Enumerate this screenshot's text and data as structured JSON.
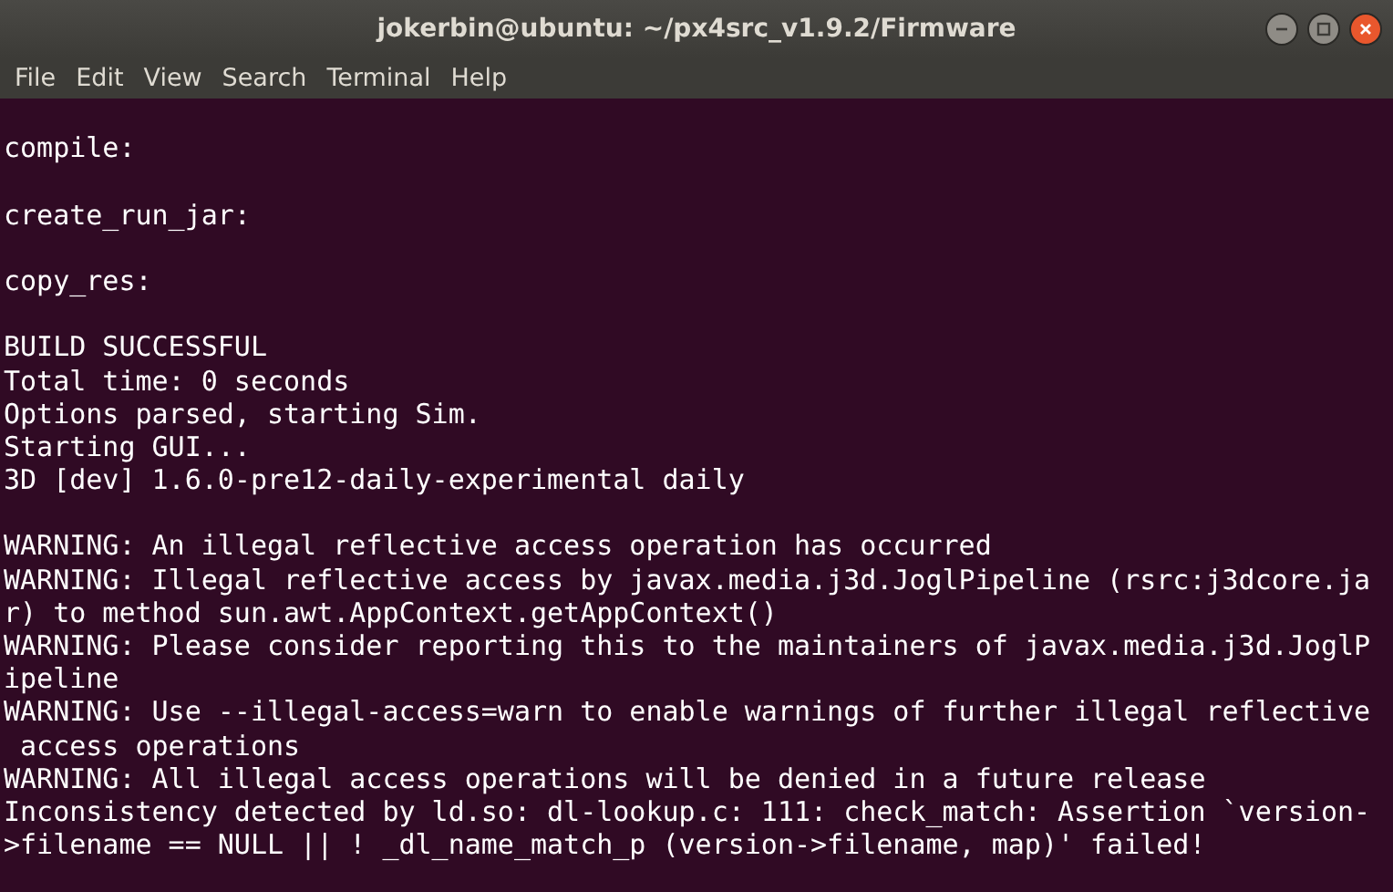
{
  "window": {
    "title": "jokerbin@ubuntu: ~/px4src_v1.9.2/Firmware"
  },
  "menu": [
    "File",
    "Edit",
    "View",
    "Search",
    "Terminal",
    "Help"
  ],
  "terminal": {
    "lines": [
      {
        "kind": "blank"
      },
      {
        "kind": "text",
        "text": "compile:"
      },
      {
        "kind": "blank"
      },
      {
        "kind": "text",
        "text": "create_run_jar:"
      },
      {
        "kind": "blank"
      },
      {
        "kind": "text",
        "text": "copy_res:"
      },
      {
        "kind": "blank"
      },
      {
        "kind": "text",
        "text": "BUILD SUCCESSFUL"
      },
      {
        "kind": "text",
        "text": "Total time: 0 seconds"
      },
      {
        "kind": "text",
        "text": "Options parsed, starting Sim."
      },
      {
        "kind": "text",
        "text": "Starting GUI..."
      },
      {
        "kind": "text",
        "text": "3D [dev] 1.6.0-pre12-daily-experimental daily"
      },
      {
        "kind": "blank"
      },
      {
        "kind": "text",
        "text": "WARNING: An illegal reflective access operation has occurred"
      },
      {
        "kind": "text",
        "text": "WARNING: Illegal reflective access by javax.media.j3d.JoglPipeline (rsrc:j3dcore.ja"
      },
      {
        "kind": "text",
        "text": "r) to method sun.awt.AppContext.getAppContext()"
      },
      {
        "kind": "text",
        "text": "WARNING: Please consider reporting this to the maintainers of javax.media.j3d.JoglP"
      },
      {
        "kind": "text",
        "text": "ipeline"
      },
      {
        "kind": "text",
        "text": "WARNING: Use --illegal-access=warn to enable warnings of further illegal reflective"
      },
      {
        "kind": "text",
        "text": " access operations"
      },
      {
        "kind": "text",
        "text": "WARNING: All illegal access operations will be denied in a future release"
      },
      {
        "kind": "text",
        "text": "Inconsistency detected by ld.so: dl-lookup.c: 111: check_match: Assertion `version-"
      },
      {
        "kind": "text",
        "text": ">filename == NULL || ! _dl_name_match_p (version->filename, map)' failed!"
      }
    ]
  }
}
